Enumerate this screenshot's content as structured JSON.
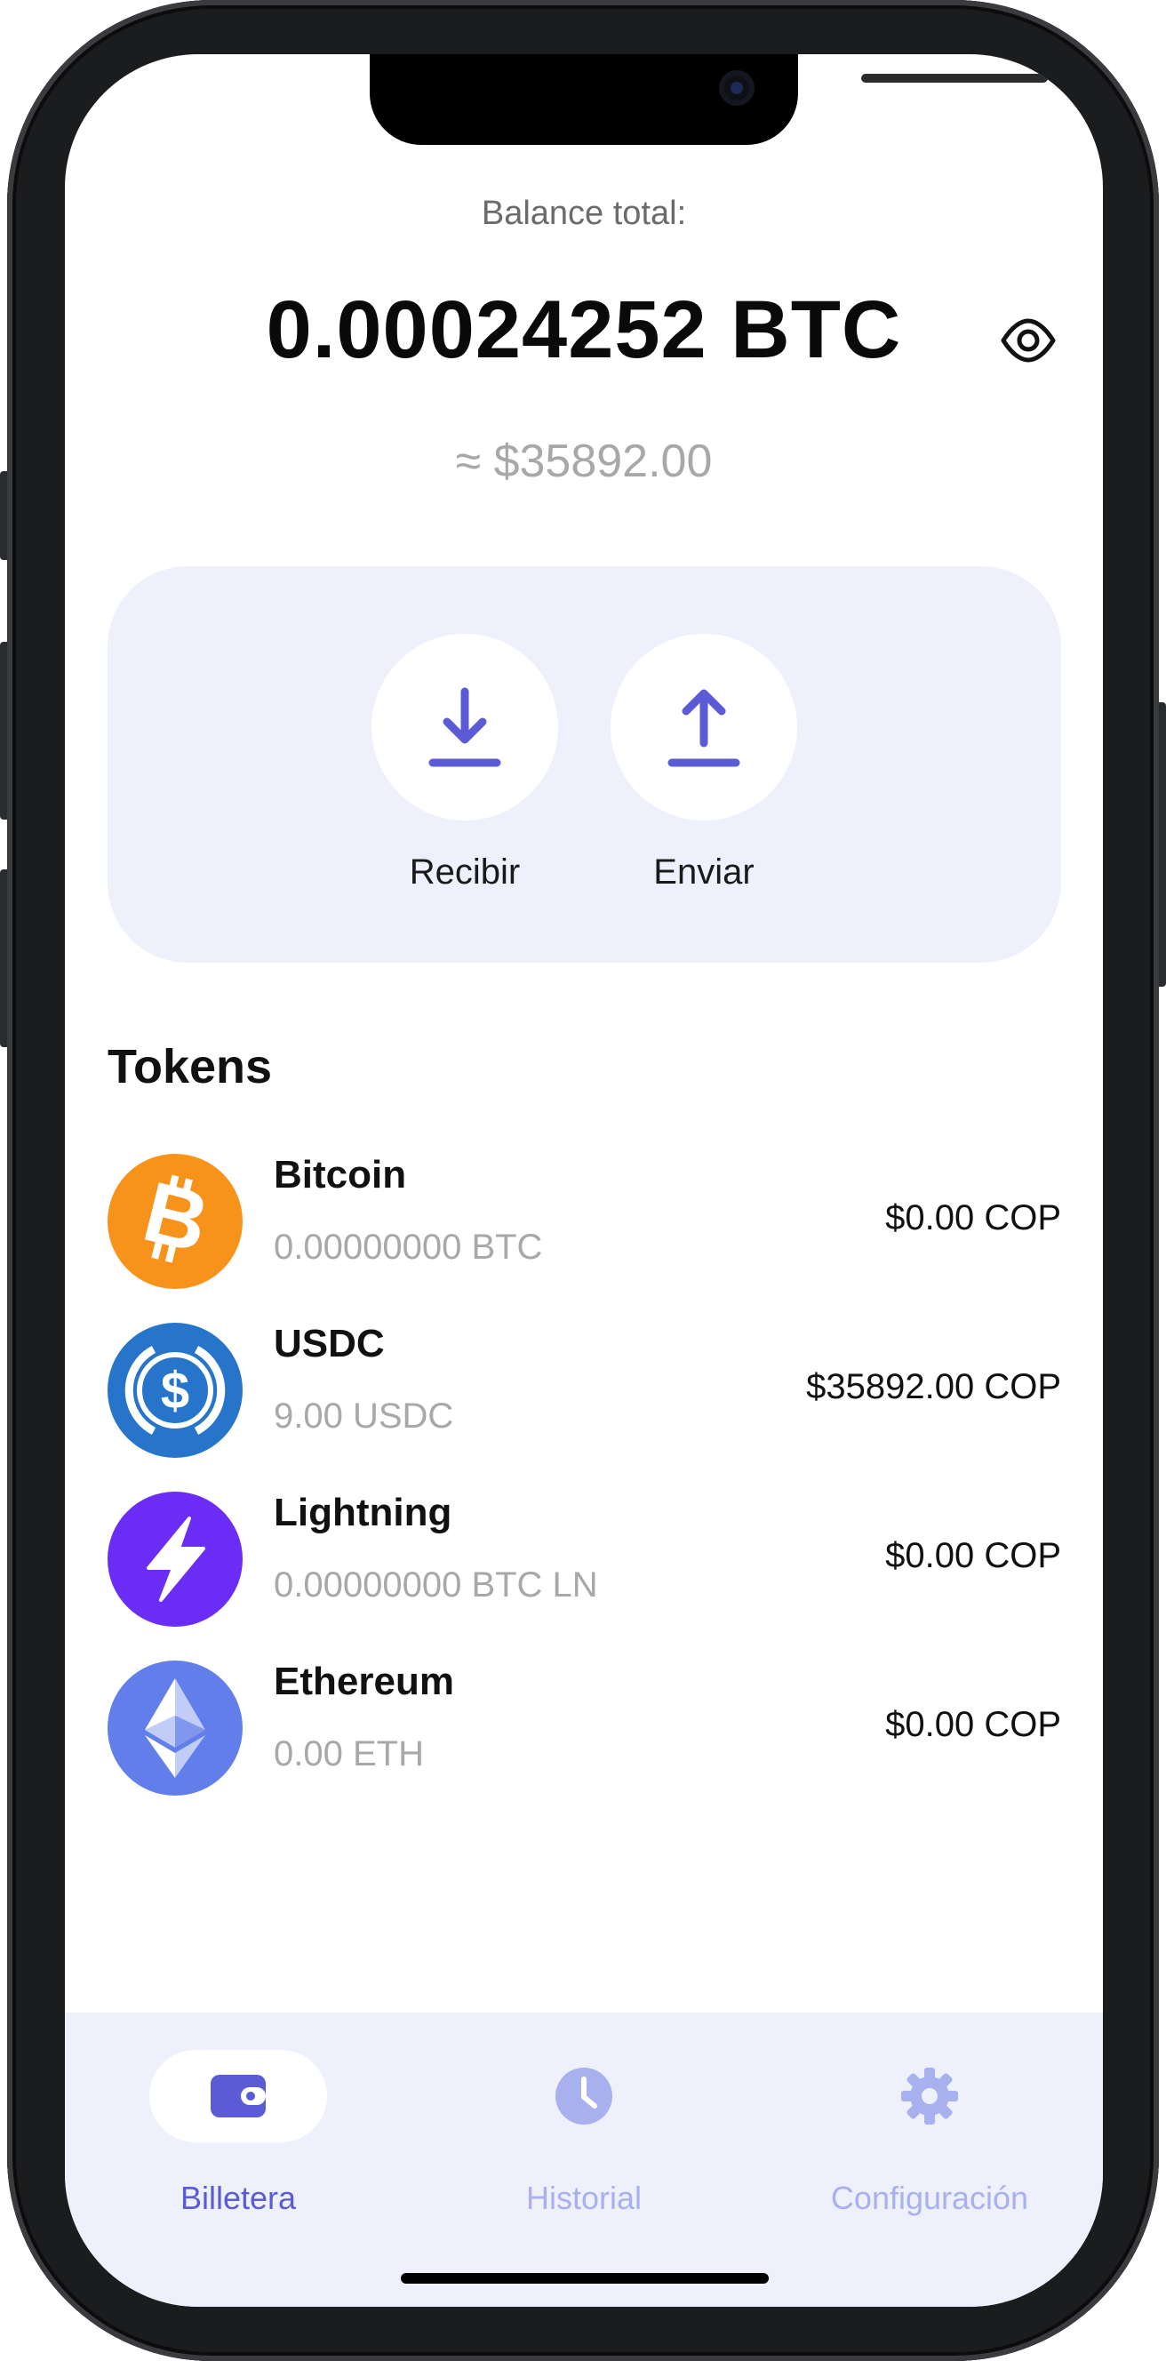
{
  "balance": {
    "label": "Balance total:",
    "btc_value": "0.00024252 BTC",
    "fiat_value": "≈ $35892.00"
  },
  "actions": {
    "receive_label": "Recibir",
    "send_label": "Enviar"
  },
  "tokens": {
    "title": "Tokens",
    "items": [
      {
        "name": "Bitcoin",
        "amount": "0.00000000 BTC",
        "fiat": "$0.00 COP",
        "icon": "bitcoin-icon",
        "color": "#f7931a"
      },
      {
        "name": "USDC",
        "amount": "9.00 USDC",
        "fiat": "$35892.00 COP",
        "icon": "usdc-icon",
        "color": "#2775ca"
      },
      {
        "name": "Lightning",
        "amount": "0.00000000 BTC LN",
        "fiat": "$0.00 COP",
        "icon": "lightning-icon",
        "color": "#6b2cf5"
      },
      {
        "name": "Ethereum",
        "amount": "0.00 ETH",
        "fiat": "$0.00 COP",
        "icon": "ethereum-icon",
        "color": "#627eea"
      }
    ]
  },
  "tabbar": {
    "tabs": [
      {
        "label": "Billetera",
        "icon": "wallet-icon",
        "active": true
      },
      {
        "label": "Historial",
        "icon": "clock-icon",
        "active": false
      },
      {
        "label": "Configuración",
        "icon": "gear-icon",
        "active": false
      }
    ]
  },
  "colors": {
    "accent": "#5b5bd6",
    "card_bg": "#eef1fc",
    "muted_text": "#a8a8a8",
    "inactive_tab": "#a9b0ee"
  }
}
